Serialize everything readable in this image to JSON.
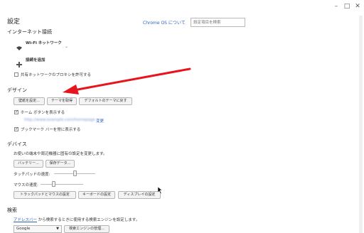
{
  "window": {
    "title": "設定",
    "about_link": "Chrome OS について",
    "search_placeholder": "設定項目を検索",
    "controls": {
      "minimize": "–",
      "maximize": "□",
      "close": "✕"
    }
  },
  "internet": {
    "heading": "インターネット接続",
    "wifi_label": "Wi-Fi ネットワーク",
    "add_connection": "接続を追加",
    "proxy_label": "共有ネットワークのプロキシを許可する"
  },
  "design": {
    "heading": "デザイン",
    "buttons": [
      "壁紙を設定...",
      "テーマを取得",
      "デフォルトのテーマに戻す"
    ],
    "home_button_label": "ホーム ボタンを表示する",
    "home_change_link": "変更",
    "bookmark_bar_label": "ブックマーク バーを常に表示する"
  },
  "device": {
    "heading": "デバイス",
    "description": "お使いの端末や周辺機器に固有の設定を変更します。",
    "buttons_row1": [
      "バッテリー...",
      "保存データ..."
    ],
    "touchpad_speed_label": "タッチパッドの速度:",
    "mouse_speed_label": "マウスの速度:",
    "touchpad_speed_level": 0.5,
    "mouse_speed_level": 0.3,
    "buttons_row2": [
      "トラックパッドとマウスの設定",
      "キーボードの設定",
      "ディスプレイの設定"
    ]
  },
  "search": {
    "heading": "検索",
    "omnibox_link": "アドレスバー",
    "description_rest": " から検索するときに使用する検索エンジンを設定します。",
    "engine_selected": "Google",
    "manage_button": "検索エンジンの管理..."
  },
  "colors": {
    "annotation_arrow": "#e8141b",
    "link": "#2b5fbf"
  }
}
